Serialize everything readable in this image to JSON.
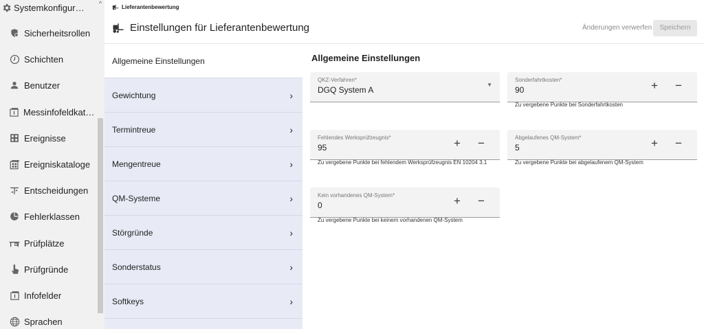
{
  "sidebar": {
    "top_label": "Systemkonfiguration",
    "items": [
      {
        "label": "Sicherheitsrollen",
        "icon": "shield-icon"
      },
      {
        "label": "Schichten",
        "icon": "clock-icon"
      },
      {
        "label": "Benutzer",
        "icon": "user-icon"
      },
      {
        "label": "Messinfofeldkataloge",
        "icon": "info-catalog-icon"
      },
      {
        "label": "Ereignisse",
        "icon": "grid-icon"
      },
      {
        "label": "Ereigniskataloge",
        "icon": "grid-catalog-icon"
      },
      {
        "label": "Entscheidungen",
        "icon": "decision-icon"
      },
      {
        "label": "Fehlerklassen",
        "icon": "pie-icon"
      },
      {
        "label": "Prüfplätze",
        "icon": "workbench-icon"
      },
      {
        "label": "Prüfgründe",
        "icon": "hand-icon"
      },
      {
        "label": "Infofelder",
        "icon": "info-icon"
      },
      {
        "label": "Sprachen",
        "icon": "globe-icon"
      }
    ]
  },
  "breadcrumb": "Lieferantenbewertung",
  "header": {
    "title": "Einstellungen für Lieferantenbewertung",
    "discard_label": "Änderungen verwerfen",
    "save_label": "Speichern"
  },
  "subnav": {
    "items": [
      "Allgemeine Einstellungen",
      "Gewichtung",
      "Termintreue",
      "Mengentreue",
      "QM-Systeme",
      "Störgründe",
      "Sonderstatus",
      "Softkeys"
    ]
  },
  "content": {
    "section_title": "Allgemeine Einstellungen",
    "qkz": {
      "label": "QKZ-Verfahren*",
      "value": "DGQ System A"
    },
    "sonderfahrt": {
      "label": "Sonderfahrtkosten*",
      "value": "90",
      "hint": "Zu vergebene Punkte bei Sonderfahrtkosten"
    },
    "werkspruef": {
      "label": "Fehlendes Werksprüfzeugnis*",
      "value": "95",
      "hint": "Zu vergebene Punkte bei fehlendem Werksprüfzeugnis EN 10204 3.1"
    },
    "abgelaufen": {
      "label": "Abgelaufenes QM-System*",
      "value": "5",
      "hint": "Zu vergebene Punkte bei abgelaufenem QM-System"
    },
    "kein": {
      "label": "Kein vorhandenes QM-System*",
      "value": "0",
      "hint": "Zu vergebene Punkte bei keinem vorhandenen QM-System"
    },
    "plus": "+",
    "minus": "−"
  }
}
